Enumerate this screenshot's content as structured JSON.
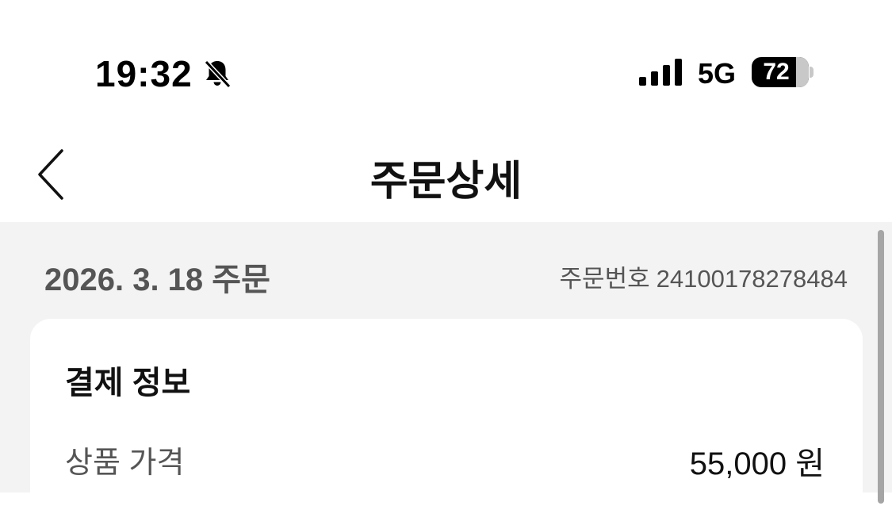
{
  "status_bar": {
    "time": "19:32",
    "network": "5G",
    "battery_level": "72"
  },
  "nav": {
    "title": "주문상세"
  },
  "order": {
    "date": "2026. 3. 18 주문",
    "number_label": "주문번호",
    "number": "24100178278484"
  },
  "payment": {
    "title": "결제 정보",
    "rows": [
      {
        "label": "상품 가격",
        "value": "55,000 원"
      }
    ]
  },
  "icons": {
    "mute": "bell-slash-icon",
    "signal": "cellular-signal-icon",
    "battery": "battery-icon",
    "back": "chevron-left-icon"
  }
}
